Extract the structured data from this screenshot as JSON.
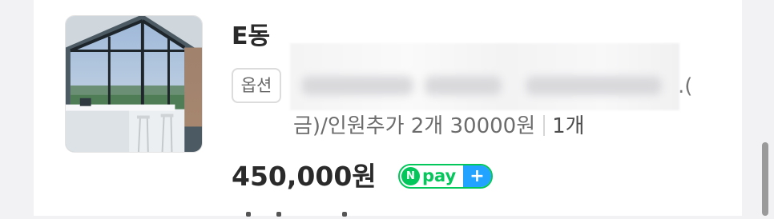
{
  "product": {
    "title": "E동",
    "option_badge": "옵션",
    "option_line1": ".(",
    "option_line2": "금)/인원추가 2개 30000원",
    "quantity": "1개",
    "price": "450,000원"
  },
  "npay": {
    "logo_letter": "N",
    "label": "pay",
    "plus": "+"
  },
  "icons": {
    "thumbnail": "room-photo",
    "pay": "npay-plus-icon"
  },
  "colors": {
    "npay_green": "#03c75a",
    "npay_blue": "#21a3ff"
  }
}
